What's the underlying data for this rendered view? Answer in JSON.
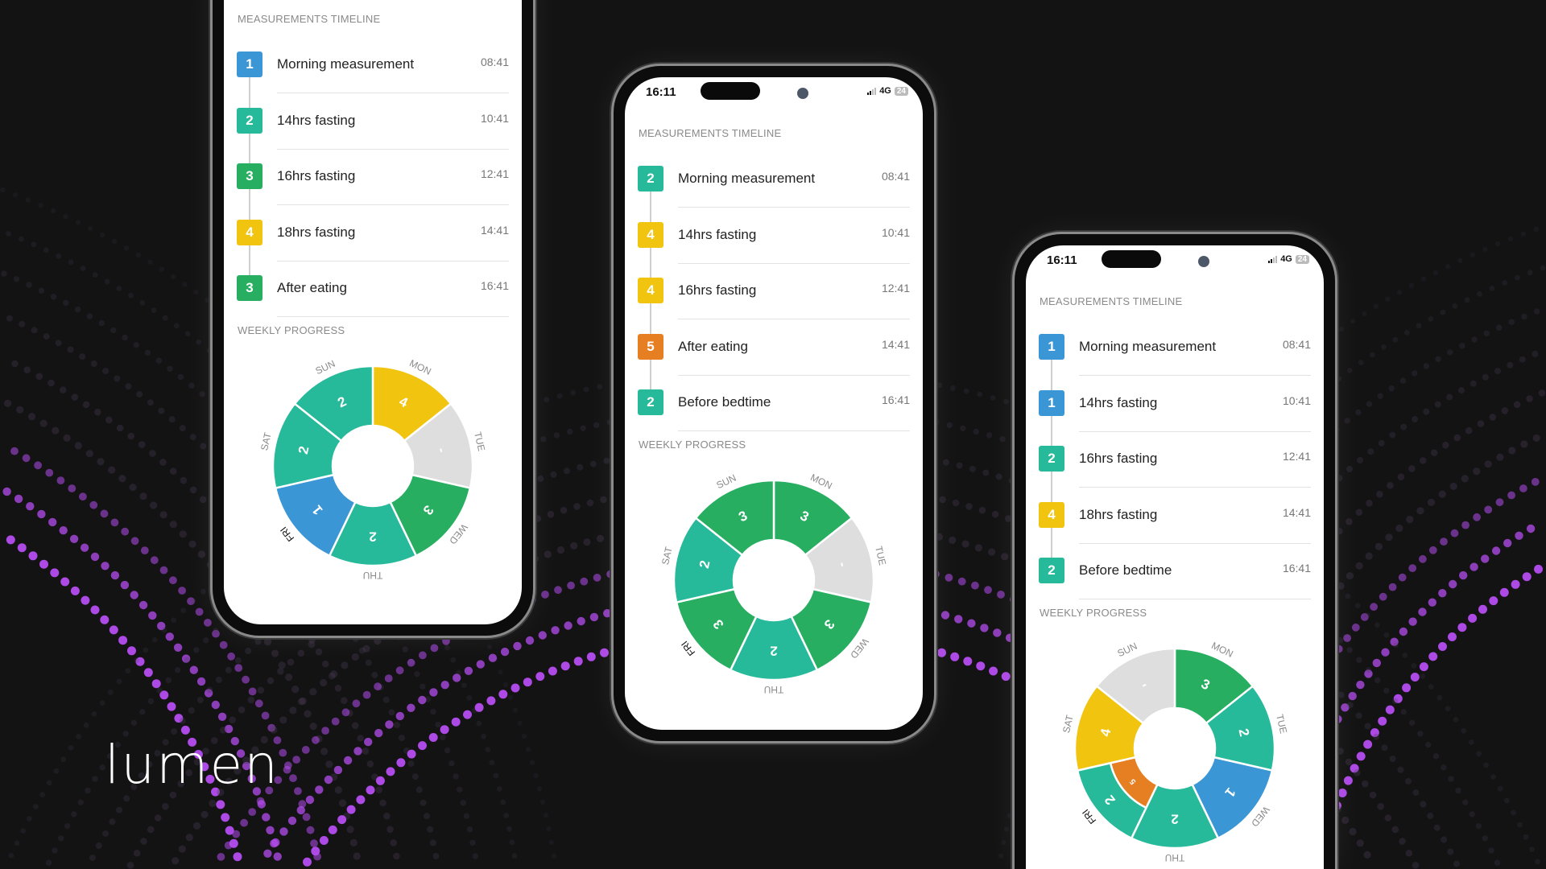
{
  "brand": {
    "logo": "lumen"
  },
  "colors": {
    "1": "#3b96d6",
    "2": "#26b99a",
    "3": "#28ae61",
    "4": "#f1c40f",
    "5": "#e67e22",
    "-": "#dedede",
    "background": "#131313",
    "accent_dots": "#b54cf0"
  },
  "phones": [
    {
      "status": null,
      "timeline_label": "MEASUREMENTS TIMELINE",
      "rows": [
        {
          "value": "1",
          "title": "Morning measurement",
          "time": "08:41"
        },
        {
          "value": "2",
          "title": "14hrs fasting",
          "time": "10:41"
        },
        {
          "value": "3",
          "title": "16hrs fasting",
          "time": "12:41"
        },
        {
          "value": "4",
          "title": "18hrs fasting",
          "time": "14:41"
        },
        {
          "value": "3",
          "title": "After eating",
          "time": "16:41"
        }
      ],
      "weekly_label": "WEEKLY PROGRESS",
      "highlight_day": "FRI",
      "week": [
        {
          "day": "MON",
          "value": "4"
        },
        {
          "day": "TUE",
          "value": "-"
        },
        {
          "day": "WED",
          "value": "3"
        },
        {
          "day": "THU",
          "value": "2"
        },
        {
          "day": "FRI",
          "value": "1"
        },
        {
          "day": "SAT",
          "value": "2"
        },
        {
          "day": "SUN",
          "value": "2"
        }
      ]
    },
    {
      "status": {
        "time": "16:11",
        "network": "4G",
        "battery": "24"
      },
      "timeline_label": "MEASUREMENTS TIMELINE",
      "rows": [
        {
          "value": "2",
          "title": "Morning measurement",
          "time": "08:41"
        },
        {
          "value": "4",
          "title": "14hrs fasting",
          "time": "10:41"
        },
        {
          "value": "4",
          "title": "16hrs fasting",
          "time": "12:41"
        },
        {
          "value": "5",
          "title": "After eating",
          "time": "14:41"
        },
        {
          "value": "2",
          "title": "Before bedtime",
          "time": "16:41"
        }
      ],
      "weekly_label": "WEEKLY PROGRESS",
      "highlight_day": "FRI",
      "week": [
        {
          "day": "MON",
          "value": "3"
        },
        {
          "day": "TUE",
          "value": "-"
        },
        {
          "day": "WED",
          "value": "3"
        },
        {
          "day": "THU",
          "value": "2"
        },
        {
          "day": "FRI",
          "value": "3"
        },
        {
          "day": "SAT",
          "value": "2"
        },
        {
          "day": "SUN",
          "value": "3"
        }
      ]
    },
    {
      "status": {
        "time": "16:11",
        "network": "4G",
        "battery": "24"
      },
      "timeline_label": "MEASUREMENTS TIMELINE",
      "rows": [
        {
          "value": "1",
          "title": "Morning measurement",
          "time": "08:41"
        },
        {
          "value": "1",
          "title": "14hrs fasting",
          "time": "10:41"
        },
        {
          "value": "2",
          "title": "16hrs fasting",
          "time": "12:41"
        },
        {
          "value": "4",
          "title": "18hrs fasting",
          "time": "14:41"
        },
        {
          "value": "2",
          "title": "Before bedtime",
          "time": "16:41"
        }
      ],
      "weekly_label": "WEEKLY PROGRESS",
      "highlight_day": "FRI",
      "week": [
        {
          "day": "MON",
          "value": "3"
        },
        {
          "day": "TUE",
          "value": "2"
        },
        {
          "day": "WED",
          "value": "1"
        },
        {
          "day": "THU",
          "value": "2"
        },
        {
          "day": "FRI",
          "value": "2",
          "inner": "5"
        },
        {
          "day": "SAT",
          "value": "4"
        },
        {
          "day": "SUN",
          "value": "-"
        }
      ]
    }
  ]
}
